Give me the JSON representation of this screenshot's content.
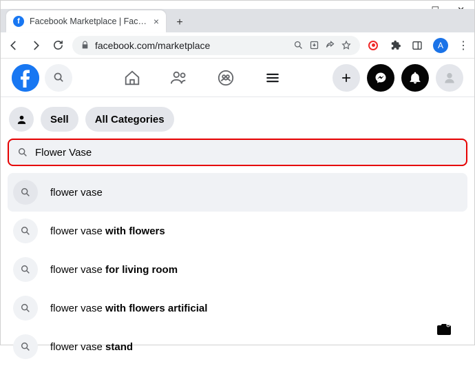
{
  "window": {
    "tab_title": "Facebook Marketplace | Facebook",
    "controls": {
      "dropdown": "⌄",
      "minimize": "—",
      "maximize": "☐",
      "close": "✕"
    }
  },
  "browser": {
    "url": "facebook.com/marketplace",
    "avatar_letter": "A"
  },
  "filters": {
    "sell": "Sell",
    "all_categories": "All Categories"
  },
  "search": {
    "value": "Flower Vase"
  },
  "suggestions": [
    {
      "prefix": "flower vase",
      "bold": ""
    },
    {
      "prefix": "flower vase ",
      "bold": "with flowers"
    },
    {
      "prefix": "flower vase ",
      "bold": "for living room"
    },
    {
      "prefix": "flower vase ",
      "bold": "with flowers artificial"
    },
    {
      "prefix": "flower vase ",
      "bold": "stand"
    }
  ]
}
